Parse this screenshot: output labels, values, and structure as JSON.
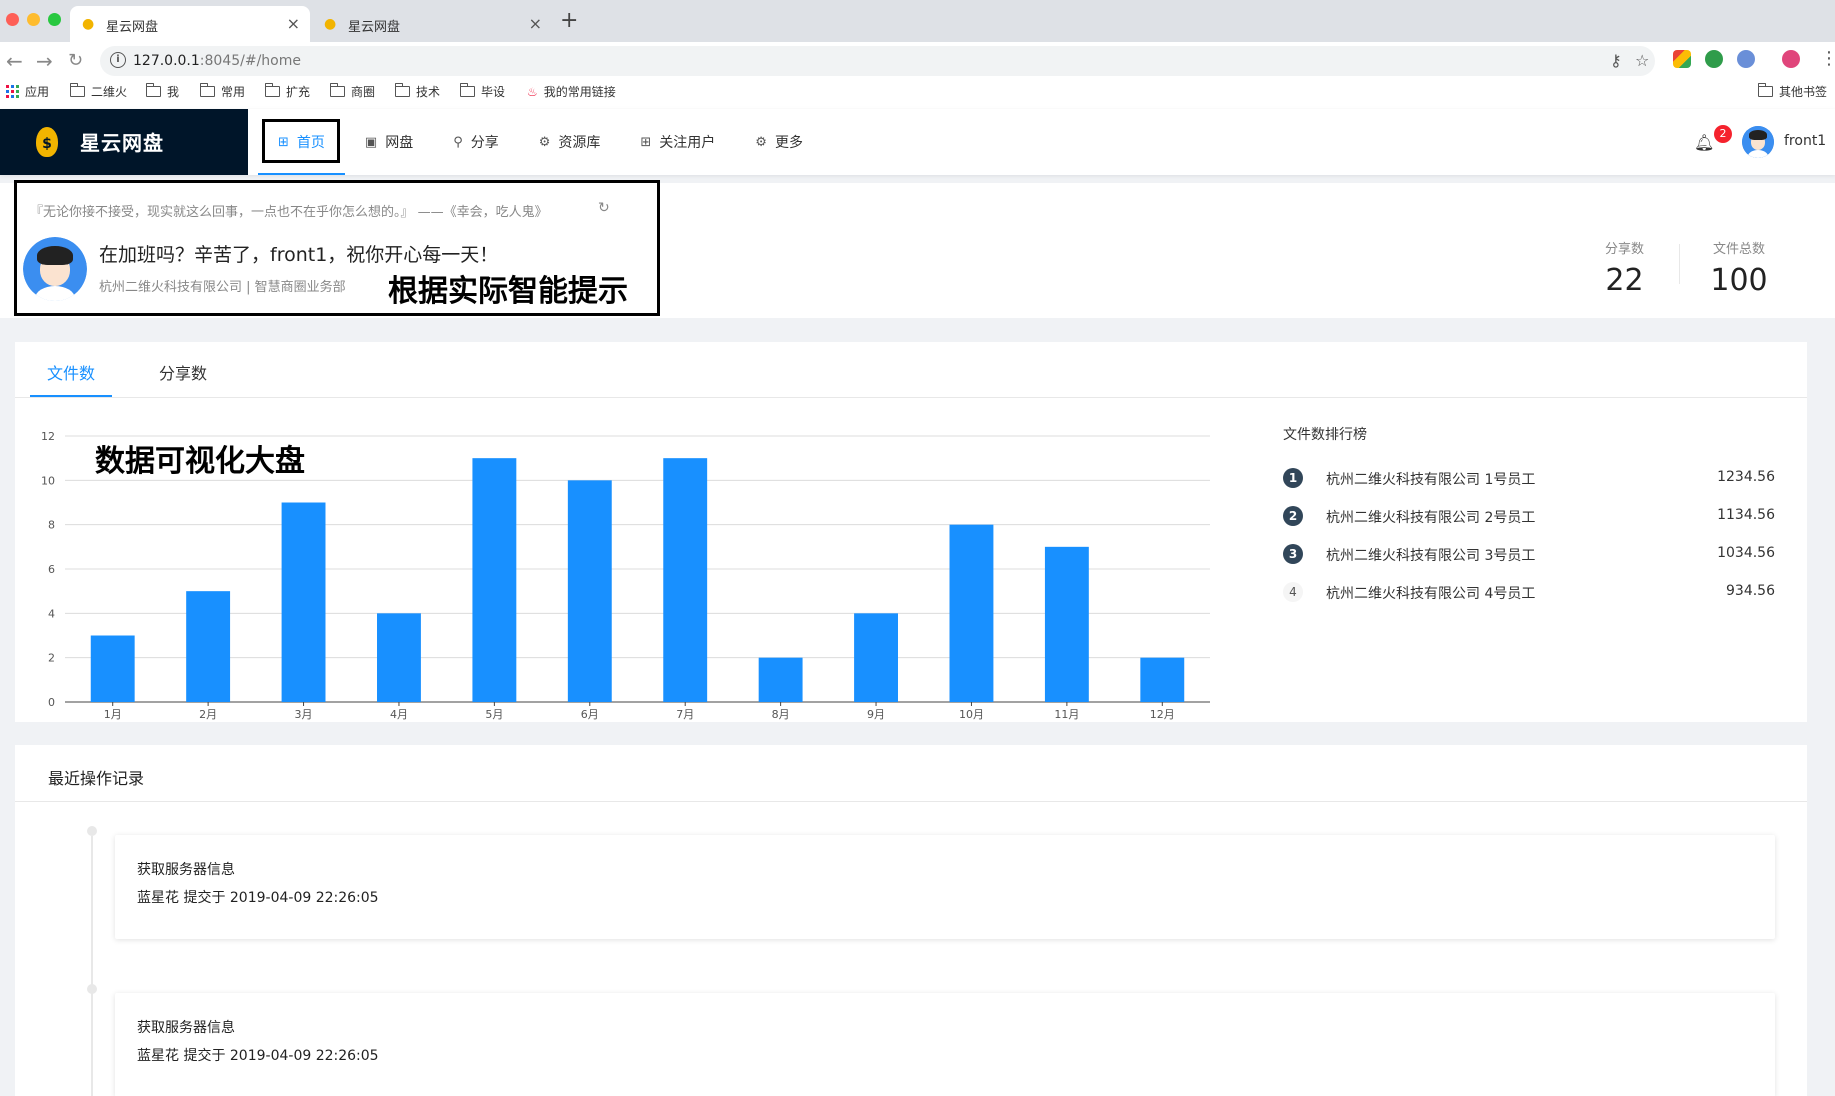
{
  "browser": {
    "tabs": [
      {
        "title": "星云网盘",
        "active": true
      },
      {
        "title": "星云网盘",
        "active": false
      }
    ],
    "url_host": "127.0.0.1",
    "url_rest": ":8045/#/home",
    "bookmarks": [
      "应用",
      "二维火",
      "我",
      "常用",
      "扩充",
      "商圈",
      "技术",
      "毕设",
      "我的常用链接"
    ],
    "other_bookmarks": "其他书签"
  },
  "app": {
    "logo_text": "星云网盘",
    "menu": [
      {
        "label": "首页",
        "icon": "grid-icon",
        "active": true
      },
      {
        "label": "网盘",
        "icon": "disk-icon",
        "active": false
      },
      {
        "label": "分享",
        "icon": "share-icon",
        "active": false
      },
      {
        "label": "资源库",
        "icon": "settings-icon",
        "active": false
      },
      {
        "label": "关注用户",
        "icon": "grid-icon",
        "active": false
      },
      {
        "label": "更多",
        "icon": "settings-icon",
        "active": false
      }
    ],
    "notification_count": "2",
    "username": "front1"
  },
  "welcome": {
    "quote": "『无论你接不接受，现实就这么回事，一点也不在乎你怎么想的。』 ——《幸会，吃人鬼》",
    "greeting": "在加班吗？辛苦了，front1，祝你开心每一天！",
    "company": "杭州二维火科技有限公司 | 智慧商圈业务部",
    "annotation": "根据实际智能提示",
    "stats": [
      {
        "label": "分享数",
        "value": "22"
      },
      {
        "label": "文件总数",
        "value": "100"
      }
    ]
  },
  "chart_section": {
    "tabs": [
      "文件数",
      "分享数"
    ],
    "annotation": "数据可视化大盘",
    "ranking_title": "文件数排行榜",
    "ranking": [
      {
        "rank": "1",
        "name": "杭州二维火科技有限公司 1号员工",
        "value": "1234.56"
      },
      {
        "rank": "2",
        "name": "杭州二维火科技有限公司 2号员工",
        "value": "1134.56"
      },
      {
        "rank": "3",
        "name": "杭州二维火科技有限公司 3号员工",
        "value": "1034.56"
      },
      {
        "rank": "4",
        "name": "杭州二维火科技有限公司 4号员工",
        "value": "934.56"
      }
    ]
  },
  "chart_data": {
    "type": "bar",
    "categories": [
      "1月",
      "2月",
      "3月",
      "4月",
      "5月",
      "6月",
      "7月",
      "8月",
      "9月",
      "10月",
      "11月",
      "12月"
    ],
    "values": [
      3,
      5,
      9,
      4,
      11,
      10,
      11,
      2,
      4,
      8,
      7,
      2
    ],
    "yticks": [
      0,
      2,
      4,
      6,
      8,
      10,
      12
    ],
    "ylim": [
      0,
      12
    ],
    "grid": true,
    "bar_color": "#1890ff",
    "title": "",
    "xlabel": "",
    "ylabel": ""
  },
  "activity": {
    "title": "最近操作记录",
    "items": [
      {
        "title": "获取服务器信息",
        "meta": "蓝星花 提交于 2019-04-09 22:26:05"
      },
      {
        "title": "获取服务器信息",
        "meta": "蓝星花 提交于 2019-04-09 22:26:05"
      }
    ]
  },
  "colors": {
    "primary": "#1890ff",
    "sider": "#001529",
    "badge": "#f5222d"
  }
}
